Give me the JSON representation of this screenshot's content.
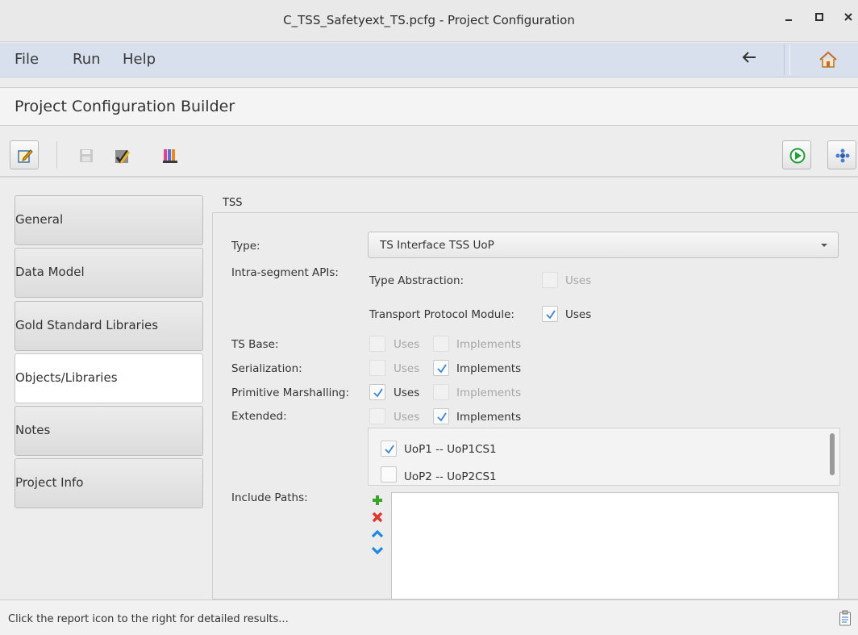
{
  "window": {
    "title": "C_TSS_Safetyext_TS.pcfg - Project Configuration",
    "controls": [
      "minimize",
      "maximize",
      "close"
    ]
  },
  "menu": {
    "items": [
      "File",
      "Run",
      "Help"
    ],
    "back_icon": "arrow-left-icon",
    "home_icon": "home-icon"
  },
  "header": {
    "title": "Project Configuration Builder"
  },
  "toolbar": {
    "left_icons": [
      "edit-icon",
      "save-icon",
      "validate-icon",
      "libraries-icon"
    ],
    "right_icons": [
      "run-icon",
      "settings-icon"
    ]
  },
  "nav": {
    "items": [
      {
        "label": "General",
        "active": false
      },
      {
        "label": "Data Model",
        "active": false
      },
      {
        "label": "Gold Standard Libraries",
        "active": false
      },
      {
        "label": "Objects/Libraries",
        "active": true
      },
      {
        "label": "Notes",
        "active": false
      },
      {
        "label": "Project Info",
        "active": false
      }
    ]
  },
  "panel": {
    "section_label": "TSS",
    "type_label": "Type:",
    "type_value": "TS Interface TSS UoP",
    "intra_label": "Intra-segment APIs:",
    "type_abstraction_label": "Type Abstraction:",
    "type_abstraction_uses": "Uses",
    "transport_label": "Transport Protocol Module:",
    "transport_uses": "Uses",
    "rows": [
      {
        "label": "TS Base:",
        "uses": "Uses",
        "implements": "Implements",
        "uses_checked": false,
        "implements_checked": false
      },
      {
        "label": "Serialization:",
        "uses": "Uses",
        "implements": "Implements",
        "uses_checked": false,
        "implements_checked": true
      },
      {
        "label": "Primitive Marshalling:",
        "uses": "Uses",
        "implements": "Implements",
        "uses_checked": true,
        "implements_checked": false
      },
      {
        "label": "Extended:",
        "uses": "Uses",
        "implements": "Implements",
        "uses_checked": false,
        "implements_checked": true
      }
    ],
    "uops": [
      {
        "label": "UoP1 -- UoP1CS1",
        "checked": true
      },
      {
        "label": "UoP2 -- UoP2CS1",
        "checked": false
      }
    ],
    "include_label": "Include Paths:",
    "include_icons": [
      "add-icon",
      "remove-icon",
      "move-up-icon",
      "move-down-icon"
    ]
  },
  "status": {
    "message": "Click the report icon to the right for detailed results...",
    "report_icon": "report-icon"
  },
  "colors": {
    "menubar_bg": "#d7e0ec",
    "check": "#3b82d6",
    "add": "#3aa629",
    "remove": "#e0352b",
    "arrows": "#1e88e5",
    "run": "#21a03a"
  }
}
